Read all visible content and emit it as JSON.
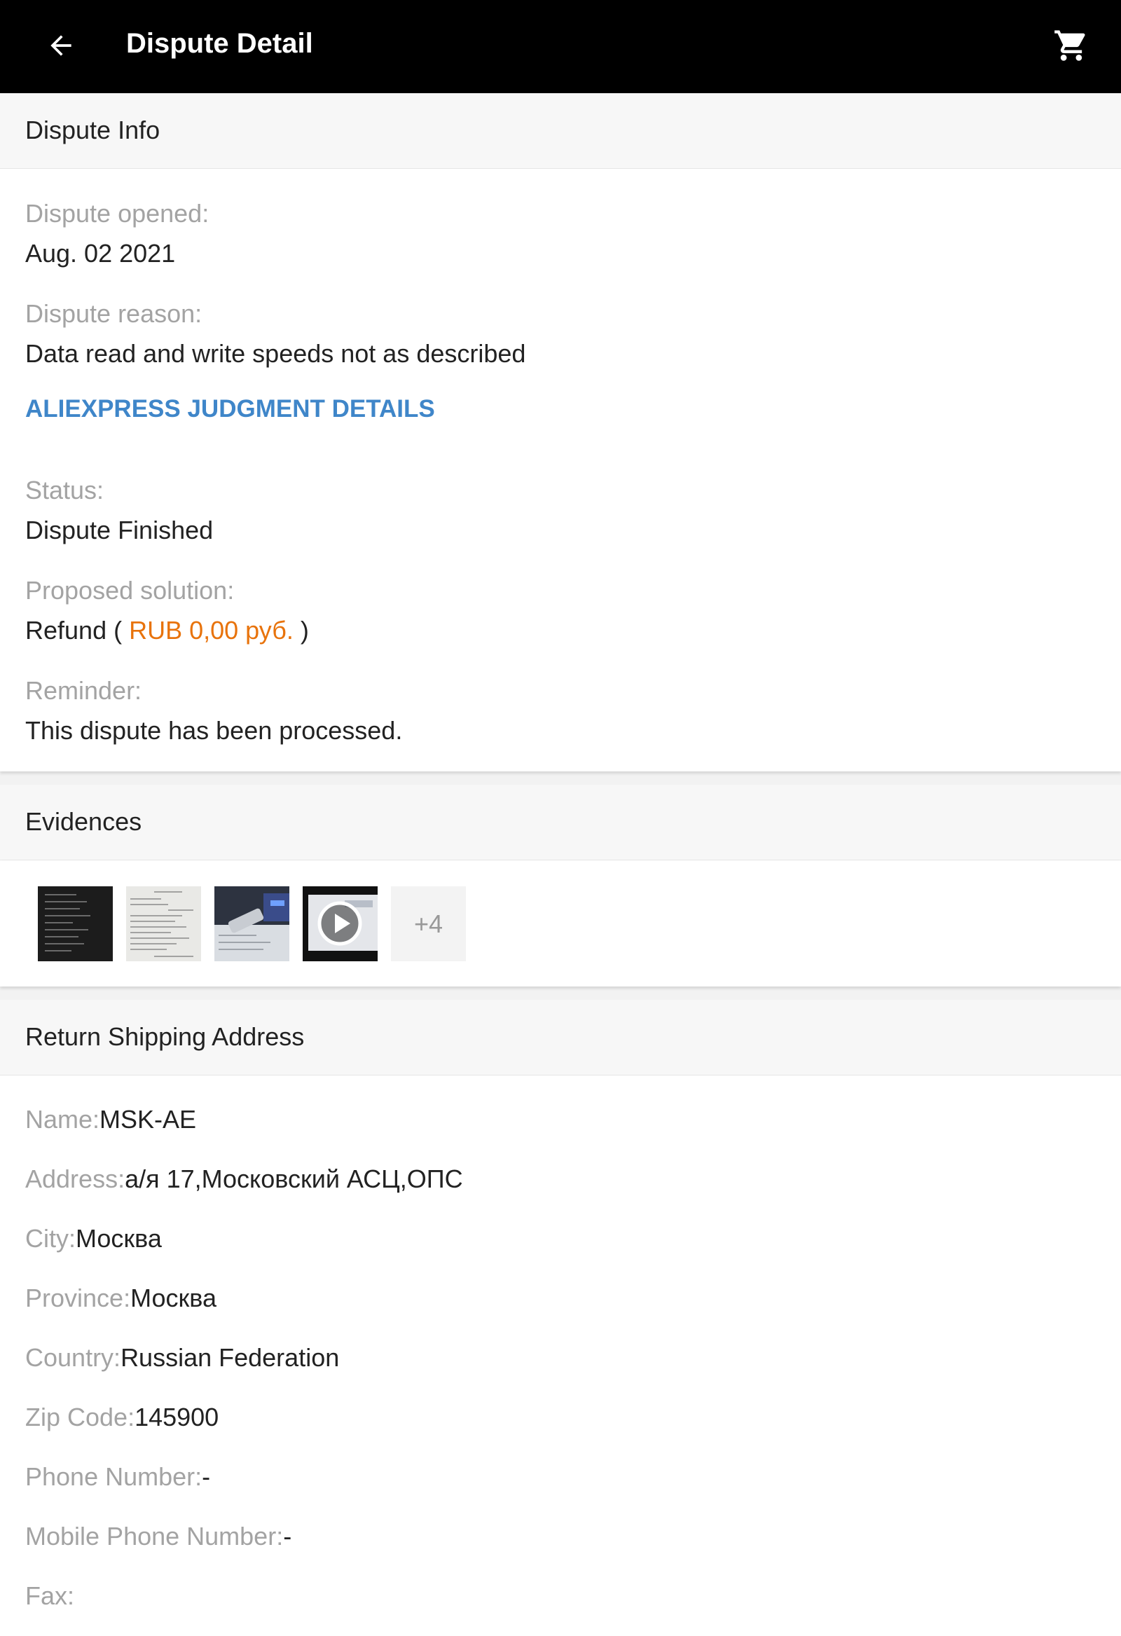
{
  "header": {
    "title": "Dispute Detail",
    "back_icon": "arrow-back-icon",
    "cart_icon": "shopping-cart-icon"
  },
  "dispute_info": {
    "section_title": "Dispute Info",
    "opened_label": "Dispute opened:",
    "opened_value": "Aug. 02 2021",
    "reason_label": "Dispute reason:",
    "reason_value": "Data read and write speeds not as described",
    "judgment_link": "ALIEXPRESS JUDGMENT DETAILS",
    "status_label": "Status:",
    "status_value": "Dispute Finished",
    "solution_label": "Proposed solution:",
    "solution_prefix": "Refund (",
    "solution_amount": "RUB 0,00 руб.",
    "solution_suffix": ")",
    "reminder_label": "Reminder:",
    "reminder_value": "This dispute has been processed."
  },
  "evidences": {
    "section_title": "Evidences",
    "more_count": "+4"
  },
  "shipping": {
    "section_title": "Return Shipping Address",
    "rows": [
      {
        "key": "Name:",
        "value": "MSK-AE"
      },
      {
        "key": "Address:",
        "value": "а/я 17,Московский АСЦ,ОПС"
      },
      {
        "key": "City:",
        "value": "Москва"
      },
      {
        "key": "Province:",
        "value": "Москва"
      },
      {
        "key": "Country:",
        "value": "Russian Federation"
      },
      {
        "key": "Zip Code:",
        "value": "145900"
      },
      {
        "key": "Phone Number:",
        "value": "-"
      },
      {
        "key": "Mobile Phone Number:",
        "value": "-"
      },
      {
        "key": "Fax:",
        "value": ""
      }
    ]
  },
  "colors": {
    "link": "#3f86c9",
    "amount": "#e8730c",
    "label": "#a3a3a3"
  }
}
